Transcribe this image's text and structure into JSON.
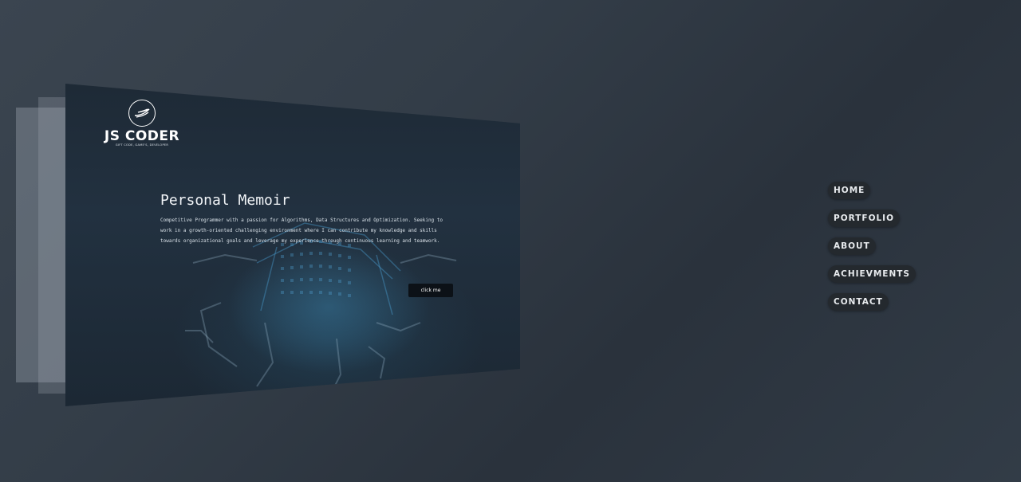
{
  "brand": {
    "name": "JS CODER",
    "tagline": "GIFT CODE, GAME'S, DEVELOPER",
    "logo_icon": "feather-wing-icon"
  },
  "hero": {
    "title": "Personal Memoir",
    "description": "Competitive Programmer with a passion for Algorithms, Data Structures and Optimization. Seeking to work in a growth-oriented challenging environment where I can contribute my knowledge and skills towards organizational goals and leverage my experience through continuous learning and teamwork.",
    "button_label": "click me"
  },
  "nav": {
    "items": [
      {
        "label": "HOME"
      },
      {
        "label": "PORTFOLIO"
      },
      {
        "label": "ABOUT"
      },
      {
        "label": "ACHIEVMENTS"
      },
      {
        "label": "CONTACT"
      }
    ]
  },
  "colors": {
    "background": "#333d48",
    "page": "#1e2a36",
    "accent": "#3c82aa",
    "nav_pill": "#24292e",
    "text": "#f1f4f7"
  }
}
